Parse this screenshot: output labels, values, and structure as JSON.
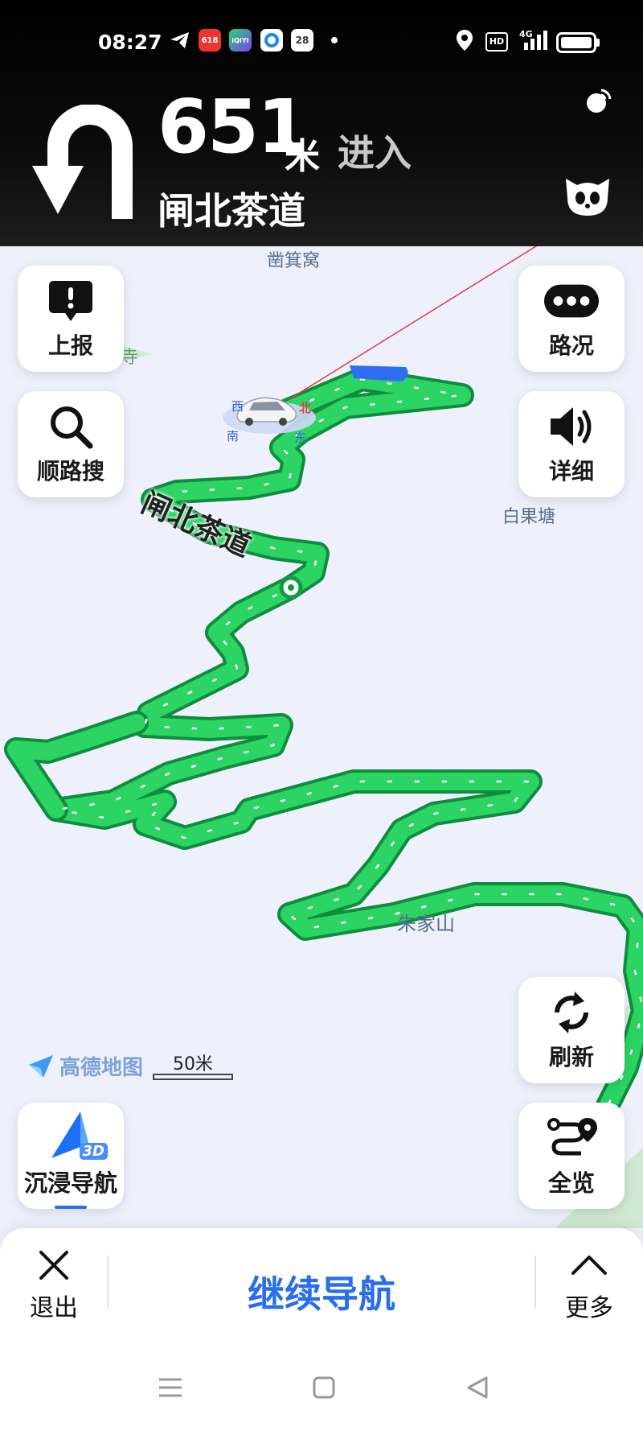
{
  "status_bar": {
    "time": "08:27",
    "app_icons": [
      "telegram-icon",
      "app-618-icon",
      "iqiyi-icon",
      "app-circle-icon",
      "calendar-28-icon"
    ],
    "calendar_day": "28",
    "iqiyi_text": "iQIYI",
    "app_618_text": "618",
    "hd_label": "HD",
    "network_label": "4G",
    "battery_level": 1.0
  },
  "navigation": {
    "maneuver_icon": "u-turn-icon",
    "distance": "651",
    "unit": "米",
    "action": "进入",
    "road": "闸北茶道"
  },
  "header_icons": [
    "signal-radar-icon",
    "assistant-cat-icon"
  ],
  "map": {
    "places": {
      "top": "凿箕窝",
      "right": "白果塘",
      "bottom": "朱家山",
      "left_partial": "寺"
    },
    "road_label": "闸北茶道",
    "compass": {
      "west": "西",
      "north": "北",
      "south": "南",
      "east": "东"
    },
    "logo_text": "高德地图",
    "scale": "50米"
  },
  "buttons": {
    "report": "上报",
    "search_along": "顺路搜",
    "traffic": "路况",
    "detail": "详细",
    "refresh": "刷新",
    "immersive": "沉浸导航",
    "immersive_badge": "3D",
    "overview": "全览"
  },
  "bottom_bar": {
    "exit": "退出",
    "continue": "继续导航",
    "more": "更多"
  },
  "colors": {
    "route": "#22c55e",
    "route_edge": "#119a43",
    "accent": "#2a6ef0",
    "map_bg": "#eef1fb"
  }
}
